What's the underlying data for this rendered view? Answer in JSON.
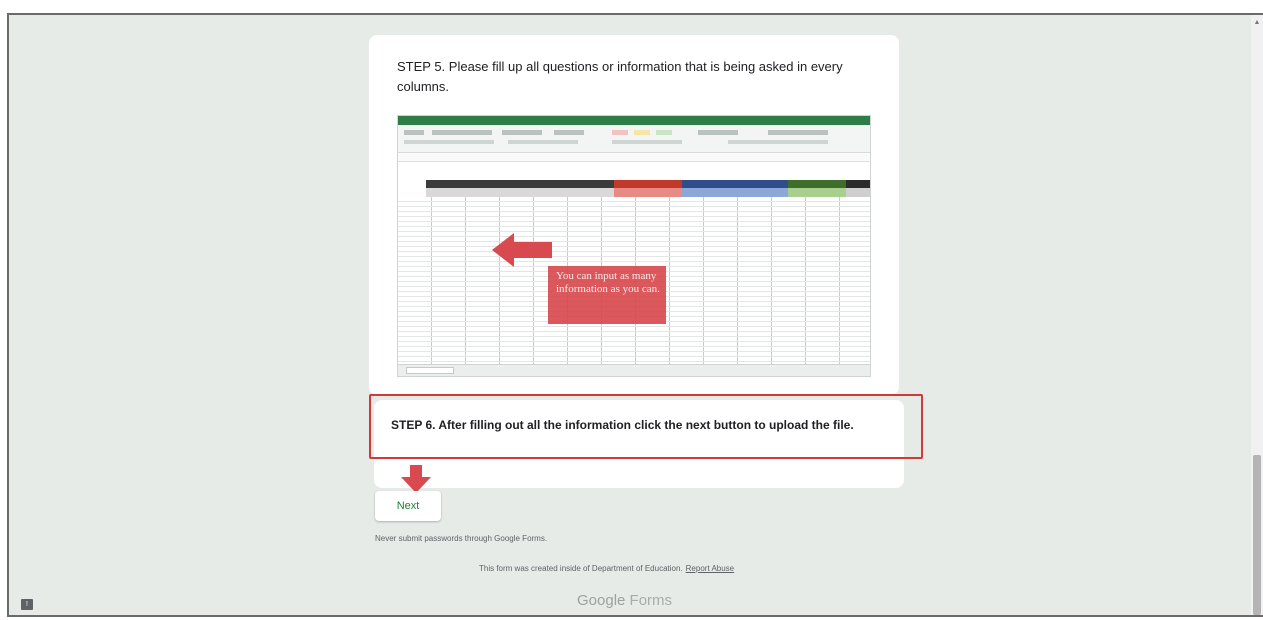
{
  "form": {
    "step5_text": "STEP 5. Please fill up all questions or information that is being asked in every columns.",
    "step5_image_callout": "You can input as many information as you can.",
    "step6_text": "STEP 6. After filling out all the information click the next button to upload the file.",
    "next_label": "Next"
  },
  "footer": {
    "warning": "Never submit passwords through Google Forms.",
    "created": "This form was created inside of Department of Education.",
    "report_abuse": "Report Abuse",
    "brand_google": "Google",
    "brand_forms": "Forms"
  },
  "colors": {
    "highlight_border": "#d23a3a",
    "arrow": "#d84a4f",
    "next_text": "#1e7d3a",
    "page_bg": "#e6ebe8"
  },
  "icons": {
    "feedback": "feedback-icon",
    "arrow_left": "left-arrow-icon",
    "arrow_down": "down-arrow-icon"
  }
}
